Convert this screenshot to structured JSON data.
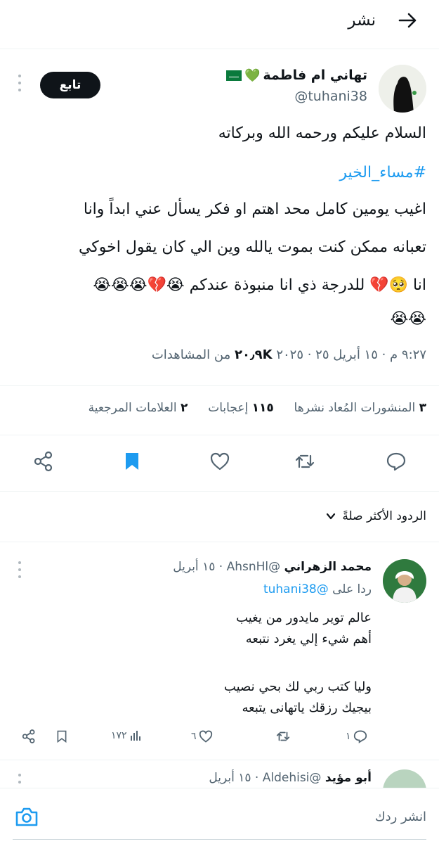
{
  "header": {
    "title": "نشر",
    "back_icon": "arrow-right-icon"
  },
  "post": {
    "author_name": "تهاني ام فاطمة",
    "author_badges": [
      "green-heart-emoji",
      "saudi-flag-emoji"
    ],
    "author_handle": "@tuhani38",
    "follow_label": "تابع",
    "greeting": "السلام عليكم ورحمه الله وبركاته",
    "hashtag": "#مساء_الخير",
    "body_line1": "اغيب يومين كامل محد اهتم او فكر يسأل عني ابداً وانا",
    "body_line2": "تعبانه  ممكن كنت بموت يالله وين الي كان يقول اخوكي",
    "body_line3": "انا 🥺💔 للدرجة ذي انا منبوذة عندكم 😭💔😭😭😭",
    "body_line4": "😭😭",
    "timestamp": "٩:٢٧ م · ١٥ أبريل ٢٥ · ٢٠٢٥",
    "views_count": "٢٠٫٩K",
    "views_label": "من المشاهدات"
  },
  "stats": {
    "reposts_count": "٣",
    "reposts_label": "المنشورات المُعاد نشرها",
    "likes_count": "١١٥",
    "likes_label": "إعجابات",
    "bookmarks_count": "٢",
    "bookmarks_label": "العلامات المرجعية"
  },
  "actions": {
    "reply_icon": "comment-icon",
    "repost_icon": "repost-icon",
    "like_icon": "heart-icon",
    "bookmark_icon": "bookmark-filled-icon",
    "share_icon": "share-icon",
    "bookmark_color": "#1d9bf0"
  },
  "replies_sort": {
    "label": "الردود الأكثر صلةً"
  },
  "reply1": {
    "name": "محمد الزهراني",
    "handle": "@AhsnHl",
    "date": "١٥ أبريل",
    "replying_to_label": "ردا على",
    "replying_to_handle": "@tuhani38",
    "line1": "عالم توير مايدور من يغيب",
    "line2": "أهم شيء إلي يغرد نتبعه",
    "line3": "وليا كتب ربي لك بحي نصيب",
    "line4": "بيجيك رزقك ياتهانى يتبعه",
    "replies_count": "١",
    "reposts_count": "",
    "likes_count": "٦",
    "views_count": "١٧٢"
  },
  "reply2": {
    "name": "أبو مؤيد",
    "handle": "@Aldehisi",
    "date": "١٥ أبريل"
  },
  "compose": {
    "placeholder": "انشر ردك",
    "camera_icon": "camera-icon",
    "accent": "#1d9bf0"
  }
}
